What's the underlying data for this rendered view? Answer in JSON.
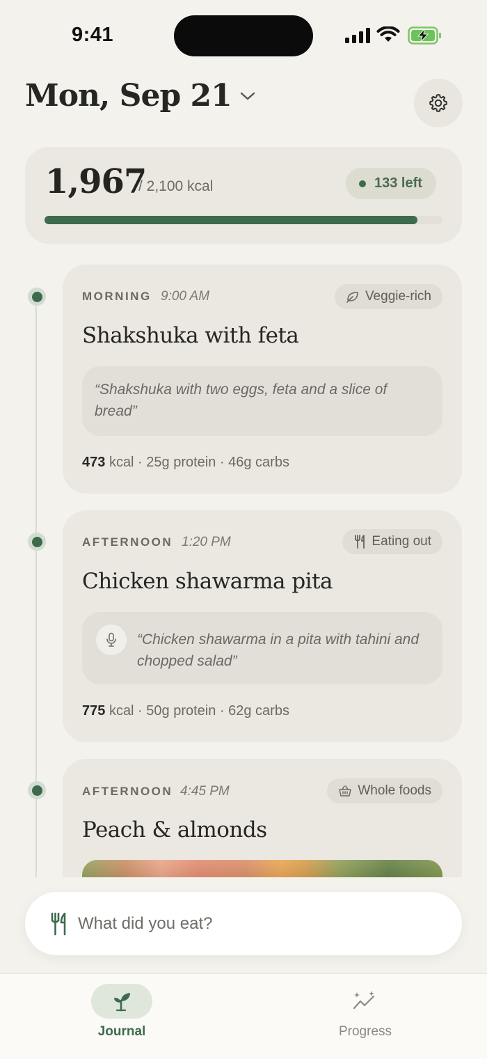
{
  "status_bar": {
    "time": "9:41"
  },
  "header": {
    "date": "Mon, Sep 21"
  },
  "summary": {
    "consumed": "1,967",
    "goal": "/ 2,100 kcal",
    "remaining": "133 left",
    "progress_fraction": 0.937
  },
  "meals": [
    {
      "period": "MORNING",
      "time": "9:00 AM",
      "tag": "Veggie-rich",
      "tag_icon": "leaf-icon",
      "name": "Shakshuka with feta",
      "quote": "“Shakshuka with two eggs, feta and a slice of bread”",
      "kcal": "473",
      "stats": "kcal · 25g protein · 46g carbs"
    },
    {
      "period": "AFTERNOON",
      "time": "1:20 PM",
      "tag": "Eating out",
      "tag_icon": "fork-knife-icon",
      "name": "Chicken shawarma pita",
      "quote": "“Chicken shawarma in a pita with tahini and chopped salad”",
      "quote_icon": "microphone-icon",
      "kcal": "775",
      "stats": "kcal · 50g protein · 62g carbs"
    },
    {
      "period": "AFTERNOON",
      "time": "4:45 PM",
      "tag": "Whole foods",
      "tag_icon": "basket-icon",
      "name": "Peach & almonds"
    }
  ],
  "input": {
    "placeholder": "What did you eat?",
    "icon": "fork-knife-icon"
  },
  "tabs": [
    {
      "label": "Journal",
      "icon": "sprout-icon",
      "active": true
    },
    {
      "label": "Progress",
      "icon": "sparkle-trend-icon",
      "active": false
    }
  ],
  "colors": {
    "accent": "#3e6a4c",
    "background": "#f4f2ed",
    "card": "#ebe8e1"
  }
}
